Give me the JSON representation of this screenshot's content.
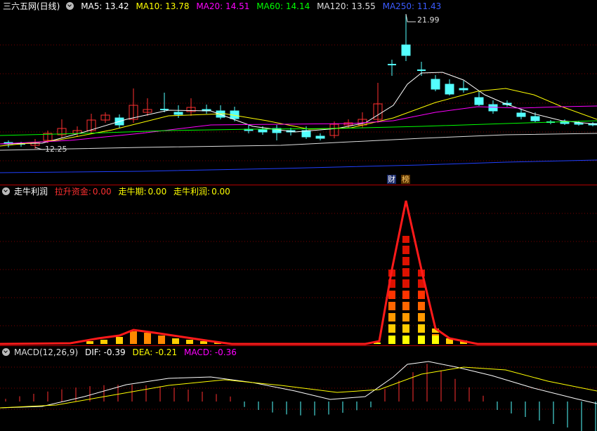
{
  "main": {
    "title": "三六五网(日线)",
    "ma": [
      {
        "label": "MA5: 13.42",
        "color": "#ffffff"
      },
      {
        "label": "MA10: 13.78",
        "color": "#ffff00"
      },
      {
        "label": "MA20: 14.51",
        "color": "#ff00ff"
      },
      {
        "label": "MA60: 14.14",
        "color": "#00ff00"
      },
      {
        "label": "MA120: 13.55",
        "color": "#dddddd"
      },
      {
        "label": "MA250: 11.43",
        "color": "#3b5bff"
      }
    ],
    "high_label": "21.99",
    "low_label": "12.25",
    "badge_cai": "财",
    "badge_bang": "榜"
  },
  "mid": {
    "title": "走牛利润",
    "items": [
      {
        "label": "拉升资金:",
        "value": "0.00",
        "color": "#ff3030"
      },
      {
        "label": "走牛期:",
        "value": "0.00",
        "color": "#ffff00"
      },
      {
        "label": "走牛利润:",
        "value": "0.00",
        "color": "#ffff00"
      }
    ]
  },
  "macd": {
    "title": "MACD(12,26,9)",
    "items": [
      {
        "label": "DIF: -0.39",
        "color": "#ffffff"
      },
      {
        "label": "DEA: -0.21",
        "color": "#ffff00"
      },
      {
        "label": "MACD: -0.36",
        "color": "#ff00ff"
      }
    ]
  },
  "colors": {
    "up": "#ff3030",
    "down": "#54ffff",
    "grid": "#7a0000"
  }
}
